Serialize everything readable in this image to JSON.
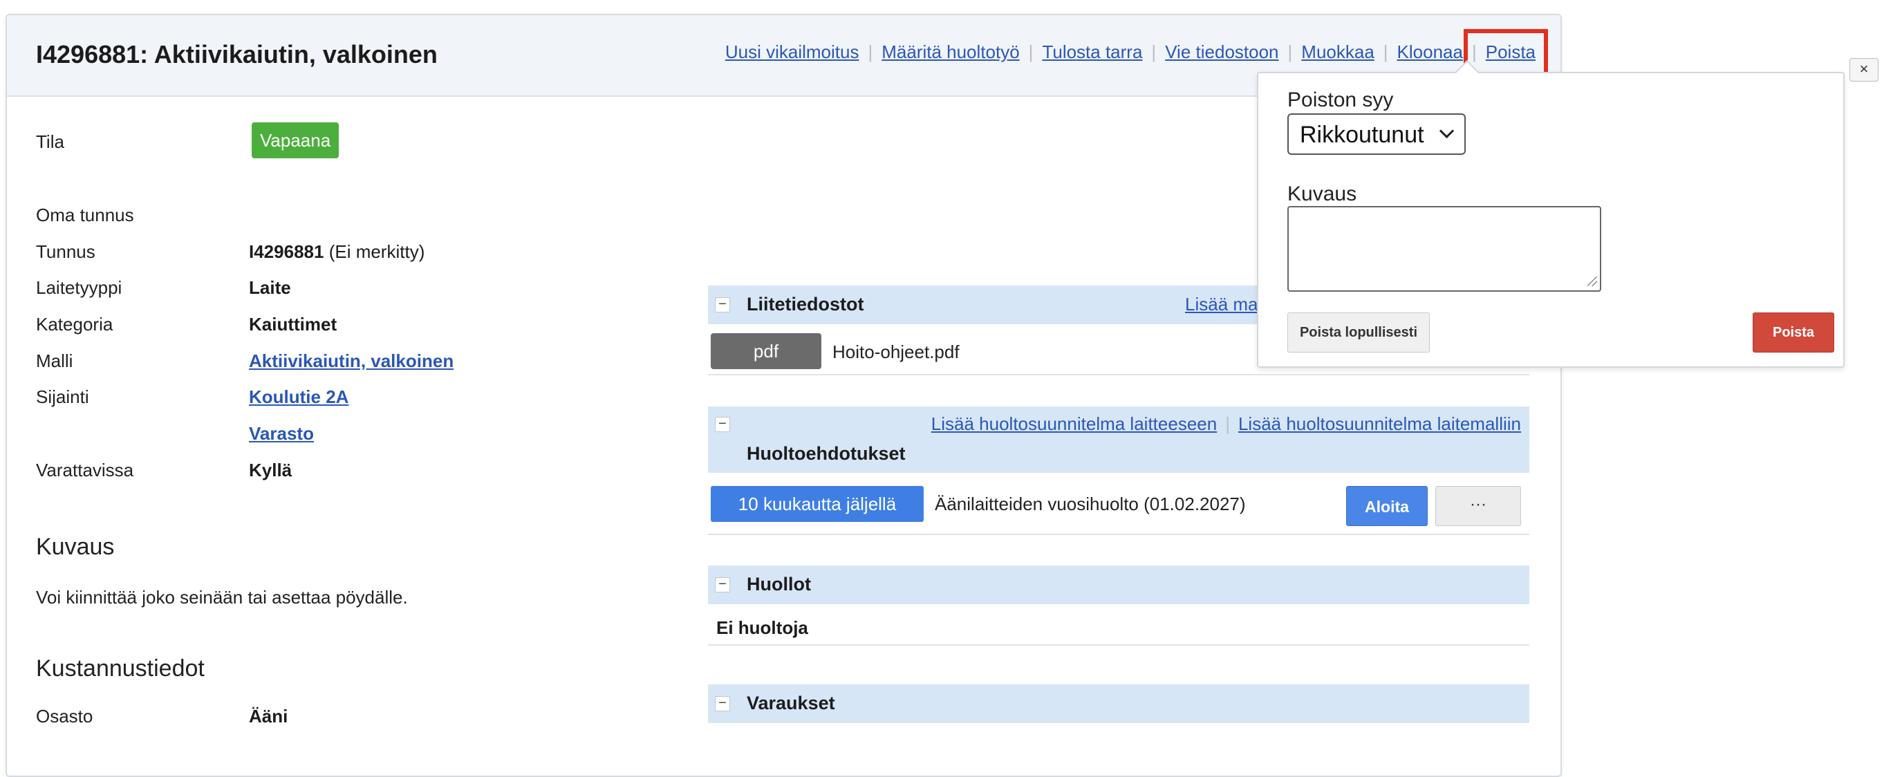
{
  "header": {
    "title": "I4296881: Aktiivikaiutin, valkoinen",
    "actions": [
      "Uusi vikailmoitus",
      "Määritä huoltotyö",
      "Tulosta tarra",
      "Vie tiedostoon",
      "Muokkaa",
      "Kloonaa",
      "Poista"
    ]
  },
  "details": {
    "status_label": "Tila",
    "status_value": "Vapaana",
    "own_id_label": "Oma tunnus",
    "id_label": "Tunnus",
    "id_value": "I4296881",
    "id_note": "(Ei merkitty)",
    "device_type_label": "Laitetyyppi",
    "device_type_value": "Laite",
    "category_label": "Kategoria",
    "category_value": "Kaiuttimet",
    "model_label": "Malli",
    "model_value": "Aktiivikaiutin, valkoinen",
    "location_label": "Sijainti",
    "location_values": [
      "Koulutie 2A",
      "Varasto"
    ],
    "bookable_label": "Varattavissa",
    "bookable_value": "Kyllä"
  },
  "description": {
    "heading": "Kuvaus",
    "text": "Voi kiinnittää joko seinään tai asettaa pöydälle."
  },
  "costs": {
    "heading": "Kustannustiedot",
    "department_label": "Osasto",
    "department_value": "Ääni"
  },
  "attachments": {
    "title": "Liitetiedostot",
    "link": "Lisää ma",
    "file_type": "pdf",
    "file_name": "Hoito-ohjeet.pdf"
  },
  "maintenance_suggestions": {
    "title": "Huoltoehdotukset",
    "links": [
      "Lisää huoltosuunnitelma laitteeseen",
      "Lisää huoltosuunnitelma laitemalliin"
    ],
    "remaining": "10 kuukautta jäljellä",
    "plan": "Äänilaitteiden vuosihuolto (01.02.2027)",
    "start_button": "Aloita",
    "more_button": "···"
  },
  "maintenances": {
    "title": "Huollot",
    "empty": "Ei huoltoja"
  },
  "reservations": {
    "title": "Varaukset"
  },
  "delete_popup": {
    "reason_label": "Poiston syy",
    "reason_value": "Rikkoutunut",
    "description_label": "Kuvaus",
    "description_value": "",
    "final_button": "Poista lopullisesti",
    "delete_button": "Poista",
    "close_label": "×"
  },
  "colors": {
    "link": "#2a57b7",
    "status_green": "#4caf3d",
    "highlight_red": "#e0301e",
    "panel_blue": "#d7e6f6",
    "delete_red": "#d0493b",
    "primary_blue": "#4a86e8"
  }
}
